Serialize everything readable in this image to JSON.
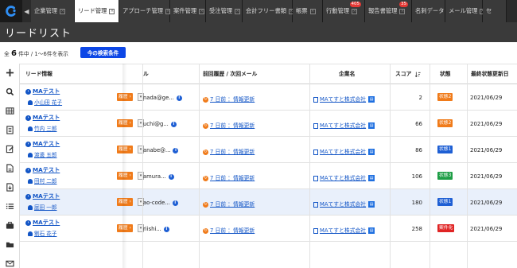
{
  "tabs": [
    {
      "label": "企業管理",
      "active": false,
      "badge": ""
    },
    {
      "label": "リード管理",
      "active": true,
      "badge": ""
    },
    {
      "label": "アプローチ管理",
      "active": false,
      "badge": ""
    },
    {
      "label": "案件管理",
      "active": false,
      "badge": ""
    },
    {
      "label": "受注管理",
      "active": false,
      "badge": ""
    },
    {
      "label": "会計フリー書類",
      "active": false,
      "badge": ""
    },
    {
      "label": "帳票",
      "active": false,
      "badge": ""
    },
    {
      "label": "行動管理",
      "active": false,
      "badge": "405"
    },
    {
      "label": "報告書管理",
      "active": false,
      "badge": "35"
    },
    {
      "label": "名刺データ",
      "active": false,
      "badge": ""
    },
    {
      "label": "メール管理",
      "active": false,
      "badge": ""
    },
    {
      "label": "セ",
      "active": false,
      "badge": ""
    }
  ],
  "page_title": "リードリスト",
  "count": {
    "prefix": "全",
    "total": "6",
    "suffix": "件中 /",
    "range": "1〜6件を表示"
  },
  "search_button": "今の検索条件",
  "columns": {
    "lead": "リード情報",
    "mail": "ル",
    "history": "前回履歴 / 次回メール",
    "company": "企業名",
    "score": "スコア",
    "status": "状態",
    "updated": "最終状態更新日"
  },
  "history_label": "履歴",
  "rows": [
    {
      "name": "MAテスト",
      "owner": "小山田 花子",
      "mail": "nada@ge...",
      "prev": "7 日前 ：情報更新",
      "company": "MAてすと株式会社",
      "score": "2",
      "status": "状態2",
      "status_color": "#f07b1a",
      "date": "2021/06/29"
    },
    {
      "name": "MAテスト",
      "owner": "竹内 三郎",
      "mail": "uchi@g...",
      "prev": "7 日前 ：情報更新",
      "company": "MAてすと株式会社",
      "score": "66",
      "status": "状態2",
      "status_color": "#f07b1a",
      "date": "2021/06/29"
    },
    {
      "name": "MAテスト",
      "owner": "渡邊 五郎",
      "mail": "anabe@...",
      "prev": "7 日前 ：情報更新",
      "company": "MAてすと株式会社",
      "score": "86",
      "status": "状態1",
      "status_color": "#1e5fd4",
      "date": "2021/06/29"
    },
    {
      "name": "MAテスト",
      "owner": "田村 二郎",
      "mail": "amura...",
      "prev": "7 日前 ：情報更新",
      "company": "MAてすと株式会社",
      "score": "106",
      "status": "状態3",
      "status_color": "#1e9e46",
      "date": "2021/06/29"
    },
    {
      "name": "MAテスト",
      "owner": "庭田 一郎",
      "mail": "ao-code...",
      "prev": "7 日前 ：情報更新",
      "company": "MAてすと株式会社",
      "score": "180",
      "status": "状態1",
      "status_color": "#1e5fd4",
      "date": "2021/06/29"
    },
    {
      "name": "MAテスト",
      "owner": "劉石 花子",
      "mail": "riishi...",
      "prev": "7 日前 ：情報更新",
      "company": "MAてすと株式会社",
      "score": "258",
      "status": "案件化",
      "status_color": "#e02424",
      "date": "2021/06/29"
    }
  ],
  "sidebar_icons": [
    "plus-icon",
    "search-icon",
    "table-icon",
    "list-icon",
    "edit-icon",
    "document-icon",
    "download-icon",
    "checklist-icon",
    "briefcase-icon",
    "folder-icon",
    "mail-icon",
    "file-icon"
  ]
}
